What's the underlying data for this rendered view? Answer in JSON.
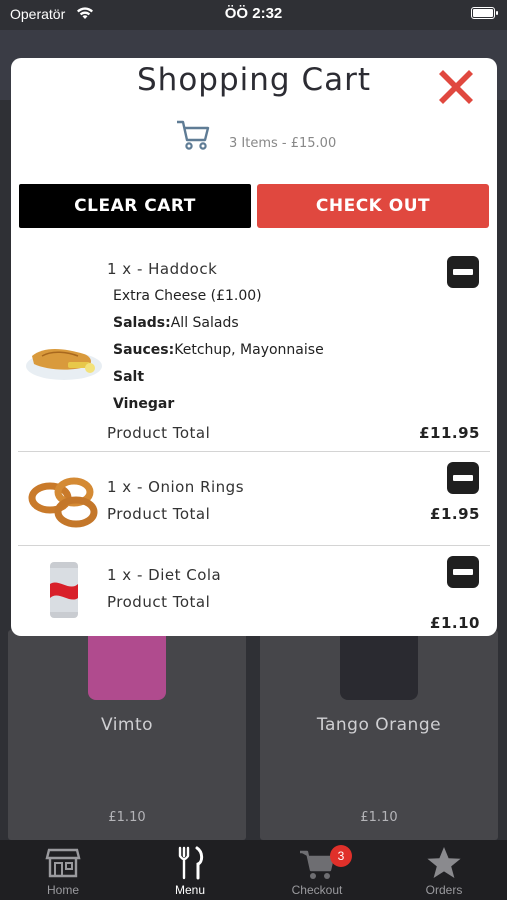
{
  "status_bar": {
    "carrier": "Operatör",
    "time": "ÖÖ 2:32"
  },
  "background": {
    "products": [
      {
        "name": "Vimto",
        "price": "£1.10"
      },
      {
        "name": "Tango Orange",
        "price": "£1.10"
      }
    ]
  },
  "cart": {
    "title": "Shopping Cart",
    "summary": "3 Items - £15.00",
    "clear_label": "CLEAR CART",
    "checkout_label": "CHECK OUT",
    "product_total_label": "Product Total",
    "items": [
      {
        "title": "1 x - Haddock",
        "options": [
          {
            "label": "",
            "value": "Extra Cheese (£1.00)"
          },
          {
            "label": "Salads:",
            "value": "All Salads"
          },
          {
            "label": "Sauces:",
            "value": "Ketchup, Mayonnaise"
          },
          {
            "label": "Salt",
            "value": ""
          },
          {
            "label": "Vinegar",
            "value": ""
          }
        ],
        "price": "£11.95"
      },
      {
        "title": "1 x - Onion Rings",
        "options": [],
        "price": "£1.95"
      },
      {
        "title": "1 x - Diet Cola",
        "options": [],
        "price": "£1.10"
      }
    ]
  },
  "tabbar": {
    "tabs": [
      {
        "label": "Home",
        "icon": "store-icon"
      },
      {
        "label": "Menu",
        "icon": "cutlery-icon"
      },
      {
        "label": "Checkout",
        "icon": "cart-icon"
      },
      {
        "label": "Orders",
        "icon": "star-icon"
      }
    ],
    "checkout_badge": "3",
    "active_tab": "Menu"
  },
  "colors": {
    "accent_red": "#e0483f",
    "badge_red": "#e0302a",
    "tabbar_bg": "#1f1f22"
  }
}
